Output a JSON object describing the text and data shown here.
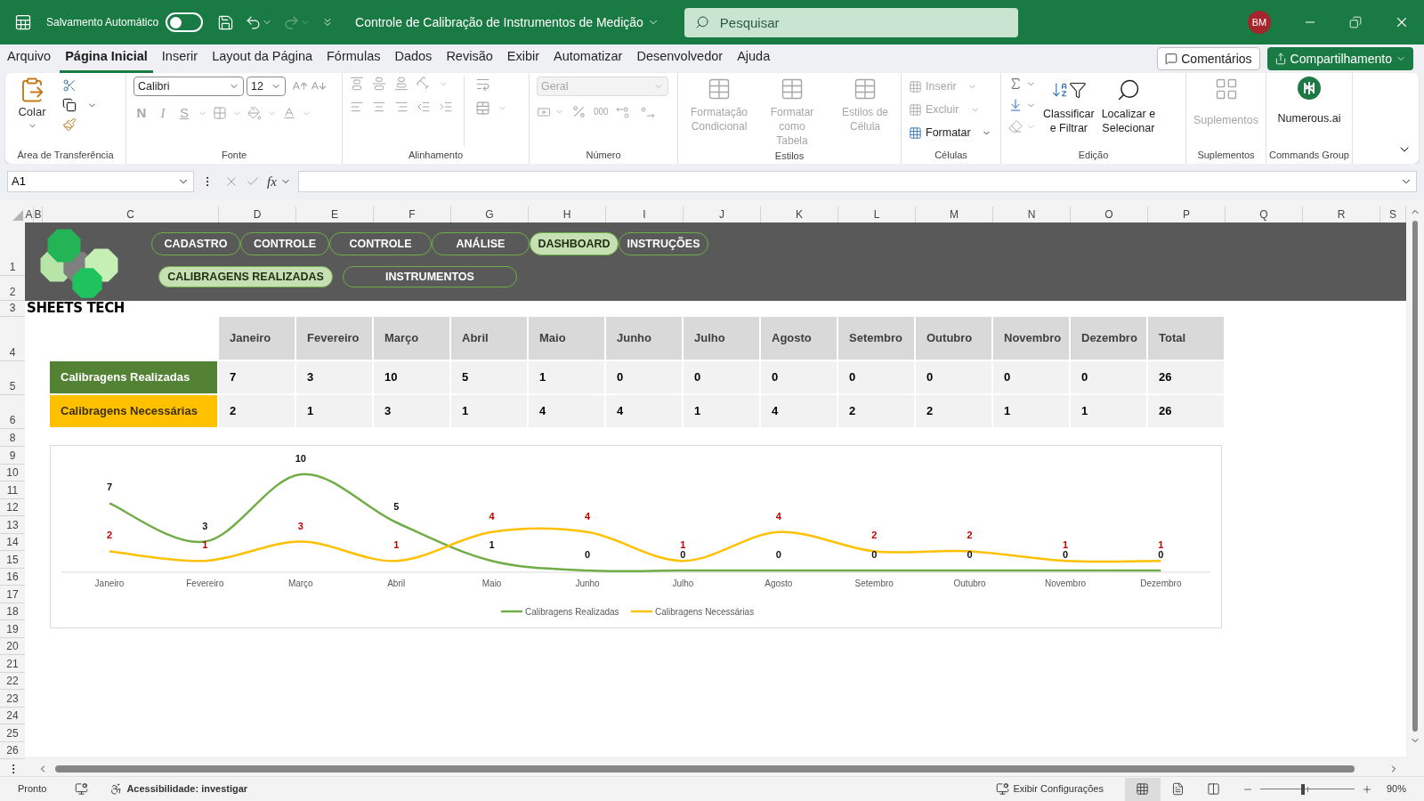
{
  "title_bar": {
    "autosave_label": "Salvamento Automático",
    "autosave_on": false,
    "document_title": "Controle de Calibração de Instrumentos de Medição",
    "search_placeholder": "Pesquisar",
    "user_initials": "BM"
  },
  "menu_tabs": [
    {
      "label": "Arquivo",
      "selected": false
    },
    {
      "label": "Página Inicial",
      "selected": true
    },
    {
      "label": "Inserir",
      "selected": false
    },
    {
      "label": "Layout da Página",
      "selected": false
    },
    {
      "label": "Fórmulas",
      "selected": false
    },
    {
      "label": "Dados",
      "selected": false
    },
    {
      "label": "Revisão",
      "selected": false
    },
    {
      "label": "Exibir",
      "selected": false
    },
    {
      "label": "Automatizar",
      "selected": false
    },
    {
      "label": "Desenvolvedor",
      "selected": false
    },
    {
      "label": "Ajuda",
      "selected": false
    }
  ],
  "comments_button": "Comentários",
  "share_button": "Compartilhamento",
  "ribbon": {
    "clipboard": {
      "paste": "Colar",
      "label": "Área de Transferência"
    },
    "font": {
      "name": "Calibri",
      "size": "12",
      "style_buttons": [
        "N",
        "I",
        "S"
      ],
      "disabled": true,
      "label": "Fonte"
    },
    "alignment": {
      "disabled": true,
      "label": "Alinhamento"
    },
    "number": {
      "format": "Geral",
      "thousands": "000",
      "disabled": true,
      "label": "Número"
    },
    "styles": {
      "buttons": [
        {
          "lines": [
            "Formatação",
            "Condicional"
          ],
          "disabled": true
        },
        {
          "lines": [
            "Formatar como",
            "Tabela"
          ],
          "disabled": true
        },
        {
          "lines": [
            "Estilos de",
            "Célula"
          ],
          "disabled": true
        }
      ],
      "label": "Estilos"
    },
    "cells": {
      "buttons": [
        {
          "label": "Inserir",
          "disabled": true
        },
        {
          "label": "Excluir",
          "disabled": true
        },
        {
          "label": "Formatar",
          "disabled": false
        }
      ],
      "label": "Células"
    },
    "editing": {
      "buttons": [
        {
          "lines": [
            "Classificar",
            "e Filtrar"
          ]
        },
        {
          "lines": [
            "Localizar e",
            "Selecionar"
          ]
        }
      ],
      "label": "Edição"
    },
    "addins": {
      "button": "Suplementos",
      "disabled": true,
      "label": "Suplementos"
    },
    "commands": {
      "button": "Numerous.ai",
      "label": "Commands Group"
    }
  },
  "formula_bar": {
    "name_box": "A1",
    "function_button": "fx"
  },
  "columns": [
    "A",
    "B",
    "C",
    "D",
    "E",
    "F",
    "G",
    "H",
    "I",
    "J",
    "K",
    "L",
    "M",
    "N",
    "O",
    "P",
    "Q",
    "R",
    "S"
  ],
  "rows": [
    "1",
    "2",
    "3",
    "4",
    "5",
    "6",
    "8",
    "9",
    "10",
    "11",
    "12",
    "13",
    "14",
    "15",
    "16",
    "17",
    "18",
    "19",
    "20",
    "21",
    "22",
    "23",
    "24",
    "25",
    "26"
  ],
  "dashboard": {
    "nav_buttons": [
      {
        "label": "CADASTRO",
        "selected": false
      },
      {
        "label": "CONTROLE",
        "selected": false
      },
      {
        "label": "CONTROLE",
        "selected": false
      },
      {
        "label": "ANÁLISE",
        "selected": false
      },
      {
        "label": "DASHBOARD",
        "selected": true
      },
      {
        "label": "INSTRUÇÕES",
        "selected": false
      }
    ],
    "sub_buttons": [
      {
        "label": "CALIBRAGENS REALIZADAS",
        "selected": true
      },
      {
        "label": "INSTRUMENTOS",
        "selected": false
      }
    ],
    "brand": "SHEETS TECH"
  },
  "table": {
    "columns": [
      "Janeiro",
      "Fevereiro",
      "Março",
      "Abril",
      "Maio",
      "Junho",
      "Julho",
      "Agosto",
      "Setembro",
      "Outubro",
      "Novembro",
      "Dezembro",
      "Total"
    ],
    "rows": [
      {
        "label": "Calibragens Realizadas",
        "color": "#548235",
        "cells": [
          "7",
          "3",
          "10",
          "5",
          "1",
          "0",
          "0",
          "0",
          "0",
          "0",
          "0",
          "0",
          "26"
        ]
      },
      {
        "label": "Calibragens Necessárias",
        "color": "#ffc000",
        "cells": [
          "2",
          "1",
          "3",
          "1",
          "4",
          "4",
          "1",
          "4",
          "2",
          "2",
          "1",
          "1",
          "26"
        ]
      }
    ]
  },
  "chart": {
    "chart_data": {
      "type": "line",
      "categories": [
        "Janeiro",
        "Fevereiro",
        "Março",
        "Abril",
        "Maio",
        "Junho",
        "Julho",
        "Agosto",
        "Setembro",
        "Outubro",
        "Novembro",
        "Dezembro"
      ],
      "series": [
        {
          "name": "Calibragens Realizadas",
          "color": "#70ad47",
          "values": [
            7,
            3,
            10,
            5,
            1,
            0,
            0,
            0,
            0,
            0,
            0,
            0
          ],
          "value_labels": [
            "7",
            "3",
            "10",
            "5",
            "1",
            "0",
            "0",
            "0",
            "0",
            "0",
            "0",
            "0"
          ]
        },
        {
          "name": "Calibragens Necessárias",
          "color": "#ffc000",
          "values": [
            2,
            1,
            3,
            1,
            4,
            4,
            1,
            4,
            2,
            2,
            1,
            1
          ],
          "value_labels": [
            "2",
            "1",
            "3",
            "1",
            "4",
            "4",
            "1",
            "4",
            "2",
            "2",
            "1",
            "1"
          ]
        }
      ],
      "data_labels": true,
      "legend": true
    }
  },
  "status_bar": {
    "status": "Pronto",
    "accessibility": "Acessibilidade: investigar",
    "display_settings": "Exibir Configurações",
    "views": [
      {
        "kind": "normal",
        "selected": true
      },
      {
        "kind": "page_layout",
        "selected": false
      },
      {
        "kind": "page_break",
        "selected": false
      }
    ],
    "zoom": {
      "level": 0.45,
      "reading": "90%"
    }
  }
}
